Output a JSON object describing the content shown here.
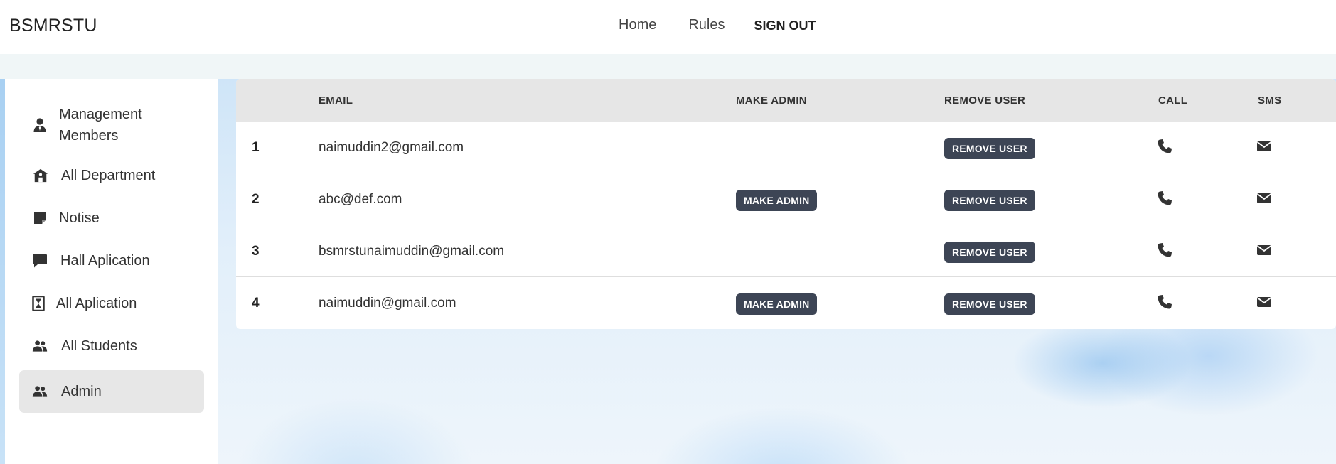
{
  "navbar": {
    "brand": "BSMRSTU",
    "links": {
      "home": "Home",
      "rules": "Rules",
      "sign_out": "SIGN OUT"
    }
  },
  "sidebar": {
    "items": [
      {
        "label": "Management Members",
        "icon": "user-tie-icon"
      },
      {
        "label": "All Department",
        "icon": "school-icon"
      },
      {
        "label": "Notise",
        "icon": "sticky-note-icon"
      },
      {
        "label": "Hall Aplication",
        "icon": "comment-icon"
      },
      {
        "label": "All Aplication",
        "icon": "hourglass-icon"
      },
      {
        "label": "All Students",
        "icon": "users-icon"
      },
      {
        "label": "Admin",
        "icon": "users-icon",
        "active": true
      }
    ]
  },
  "table": {
    "headers": {
      "email": "EMAIL",
      "make_admin": "MAKE ADMIN",
      "remove_user": "REMOVE USER",
      "call": "CALL",
      "sms": "SMS"
    },
    "rows": [
      {
        "num": "1",
        "email": "naimuddin2@gmail.com",
        "make_admin": "",
        "remove_user": "REMOVE USER"
      },
      {
        "num": "2",
        "email": "abc@def.com",
        "make_admin": "MAKE ADMIN",
        "remove_user": "REMOVE USER"
      },
      {
        "num": "3",
        "email": "bsmrstunaimuddin@gmail.com",
        "make_admin": "",
        "remove_user": "REMOVE USER"
      },
      {
        "num": "4",
        "email": "naimuddin@gmail.com",
        "make_admin": "MAKE ADMIN",
        "remove_user": "REMOVE USER"
      }
    ],
    "icons": {
      "call": "phone-icon",
      "sms": "envelope-icon"
    }
  },
  "colors": {
    "button": "#3d4555",
    "header_bg": "#e6e6e6",
    "active_item": "#e7e7e7"
  }
}
